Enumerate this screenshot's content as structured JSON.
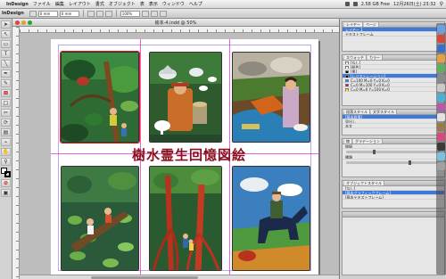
{
  "menubar": {
    "app_name": "InDesign",
    "items": [
      "ファイル",
      "編集",
      "レイアウト",
      "書式",
      "オブジェクト",
      "表",
      "表示",
      "ウィンドウ",
      "ヘルプ"
    ],
    "status": "2.58 GB Free",
    "clock": "12月26日(土) 23:32"
  },
  "controlbar": {
    "title": "InDesign",
    "x_value": "0 mm",
    "y_value": "0 mm",
    "zoom": "100%"
  },
  "document": {
    "title": "絵本-4.indd @ 50%",
    "title_text": "樹水霊生回憶図絵"
  },
  "panels": {
    "layers": {
      "tabs": [
        "レイヤー",
        "ページ"
      ],
      "rows": [
        "レイヤー 1",
        "テキストフレーム"
      ]
    },
    "swatches": {
      "tabs": [
        "スウォッチ",
        "カラー"
      ],
      "rows": [
        "[なし]",
        "[紙色]",
        "[黒]",
        "[レジストレーション]",
        "C=100 M=0 Y=0 K=0",
        "C=0 M=100 Y=0 K=0",
        "C=0 M=0 Y=100 K=0"
      ]
    },
    "paragraph": {
      "tabs": [
        "段落スタイル",
        "文字スタイル"
      ],
      "rows": [
        "[基本段落]",
        "見出し",
        "本文"
      ]
    },
    "stroke": {
      "tabs": [
        "線",
        "グラデーション"
      ],
      "rows": [
        "線幅",
        "種類"
      ]
    },
    "misc": {
      "tabs": [
        "オブジェクトスタイル"
      ],
      "rows": [
        "[なし]",
        "[基本グラフィックフレーム]",
        "[基本テキストフレーム]"
      ]
    }
  },
  "colors": {
    "accent": "#3d79d8",
    "title_red": "#8a0f1e",
    "guide": "#e61dd0"
  }
}
